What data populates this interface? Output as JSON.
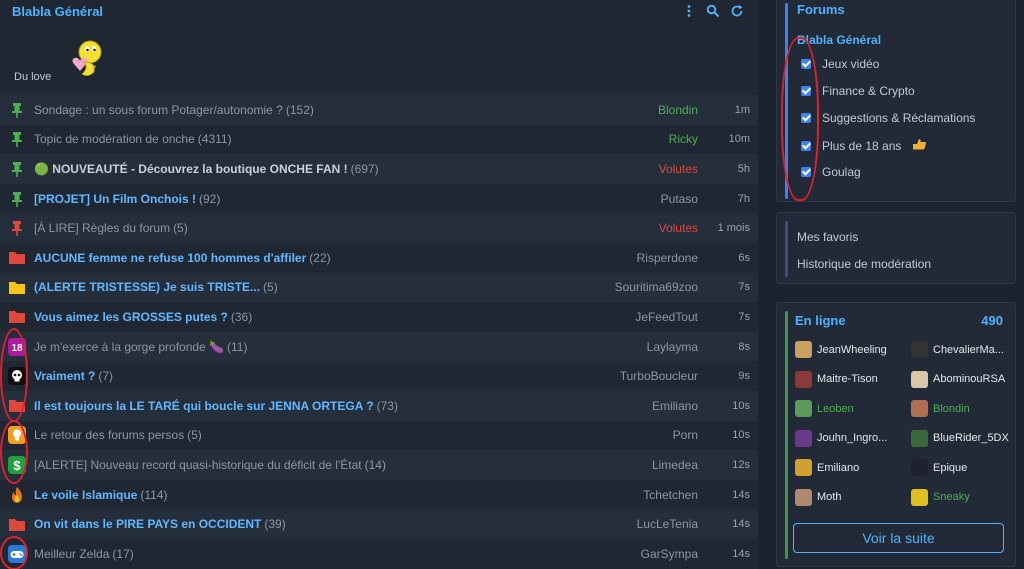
{
  "header": {
    "title": "Blabla Général"
  },
  "love": {
    "label": "Du love"
  },
  "topics": [
    {
      "icon": "pin-green",
      "title": "Sondage : un sous forum Potager/autonomie ?",
      "count": "(152)",
      "style": "normal",
      "author": "Blondin",
      "author_color": "green",
      "time": "1m"
    },
    {
      "icon": "pin-green",
      "title": "Topic de modération de onche",
      "count": "(4311)",
      "style": "normal",
      "author": "Ricky",
      "author_color": "green",
      "time": "10m"
    },
    {
      "icon": "pin-green",
      "title": "🟢 NOUVEAUTÉ - Découvrez la boutique ONCHE FAN !",
      "count": "(697)",
      "style": "bold-gray",
      "author": "Volutes",
      "author_color": "red",
      "time": "5h"
    },
    {
      "icon": "pin-green",
      "title": "[PROJET] Un Film Onchois !",
      "count": "(92)",
      "style": "bold",
      "author": "Putaso",
      "author_color": "gray",
      "time": "7h"
    },
    {
      "icon": "pin-red",
      "title": "[À LIRE] Règles du forum",
      "count": "(5)",
      "style": "normal",
      "author": "Volutes",
      "author_color": "red",
      "time": "1 mois"
    },
    {
      "icon": "folder-red",
      "title": "AUCUNE femme ne refuse 100 hommes d'affiler",
      "count": "(22)",
      "style": "bold",
      "author": "Risperdone",
      "author_color": "gray",
      "time": "6s"
    },
    {
      "icon": "folder-yellow",
      "title": "(ALERTE TRISTESSE) Je suis TRISTE...",
      "count": "(5)",
      "style": "bold",
      "author": "Souritima69zoo",
      "author_color": "gray",
      "time": "7s"
    },
    {
      "icon": "folder-red",
      "title": "Vous aimez les GROSSES putes ?",
      "count": "(36)",
      "style": "bold",
      "author": "JeFeedTout",
      "author_color": "gray",
      "time": "7s"
    },
    {
      "icon": "badge-18",
      "title": "Je m'exerce à la gorge profonde 🍆",
      "count": "(11)",
      "style": "normal",
      "author": "Laylayma",
      "author_color": "gray",
      "time": "8s"
    },
    {
      "icon": "skull-badge",
      "title": "Vraiment ?",
      "count": "(7)",
      "style": "bold",
      "author": "TurboBoucleur",
      "author_color": "gray",
      "time": "9s"
    },
    {
      "icon": "folder-red",
      "title": "Il est toujours la LE TARÉ qui boucle sur JENNA ORTEGA ?",
      "count": "(73)",
      "style": "bold",
      "author": "Emiliano",
      "author_color": "gray",
      "time": "10s"
    },
    {
      "icon": "bulb-badge",
      "title": "Le retour des forums persos",
      "count": "(5)",
      "style": "normal",
      "author": "Porn",
      "author_color": "gray",
      "time": "10s"
    },
    {
      "icon": "dollar-badge",
      "title": "[ALERTE] Nouveau record quasi-historique du déficit de l'État",
      "count": "(14)",
      "style": "normal",
      "author": "Limedea",
      "author_color": "gray",
      "time": "12s"
    },
    {
      "icon": "fire",
      "title": "Le voile Islamique",
      "count": "(114)",
      "style": "bold",
      "author": "Tchetchen",
      "author_color": "gray",
      "time": "14s"
    },
    {
      "icon": "folder-red",
      "title": "On vit dans le PIRE PAYS en OCCIDENT",
      "count": "(39)",
      "style": "bold",
      "author": "LucLeTenia",
      "author_color": "gray",
      "time": "14s"
    },
    {
      "icon": "gamepad-badge",
      "title": "Meilleur Zelda",
      "count": "(17)",
      "style": "normal",
      "author": "GarSympa",
      "author_color": "gray",
      "time": "14s"
    }
  ],
  "sidebar": {
    "forums_title": "Forums",
    "current_forum": "Blabla Général",
    "subforums": [
      "Jeux vidéo",
      "Finance & Crypto",
      "Suggestions & Réclamations",
      "Plus de 18 ans",
      "Goulag"
    ],
    "links": [
      "Mes favoris",
      "Historique de modération"
    ],
    "online_title": "En ligne",
    "online_count": "490",
    "users": [
      {
        "name": "JeanWheeling",
        "color": "white",
        "avatar": "#c9a060"
      },
      {
        "name": "ChevalierMa...",
        "color": "white",
        "avatar": "#333333"
      },
      {
        "name": "Maitre-Tison",
        "color": "white",
        "avatar": "#8b3a3a"
      },
      {
        "name": "AbominouRSA",
        "color": "white",
        "avatar": "#d8c8a8"
      },
      {
        "name": "Leoben",
        "color": "green",
        "avatar": "#5a9a5a"
      },
      {
        "name": "Blondin",
        "color": "green",
        "avatar": "#b07050"
      },
      {
        "name": "Jouhn_Ingro...",
        "color": "white",
        "avatar": "#6a3a8a"
      },
      {
        "name": "BlueRider_5DX",
        "color": "white",
        "avatar": "#3a6a3a"
      },
      {
        "name": "Emiliano",
        "color": "white",
        "avatar": "#d0a030"
      },
      {
        "name": "Epique",
        "color": "white",
        "avatar": "#202030"
      },
      {
        "name": "Moth",
        "color": "white",
        "avatar": "#b08870"
      },
      {
        "name": "Sneaky",
        "color": "green",
        "avatar": "#e0c020"
      }
    ],
    "see_more": "Voir la suite"
  },
  "colors": {
    "accent": "#4db3ff",
    "green": "#4caf50",
    "red": "#e0473b",
    "annotation": "#e0202a"
  }
}
